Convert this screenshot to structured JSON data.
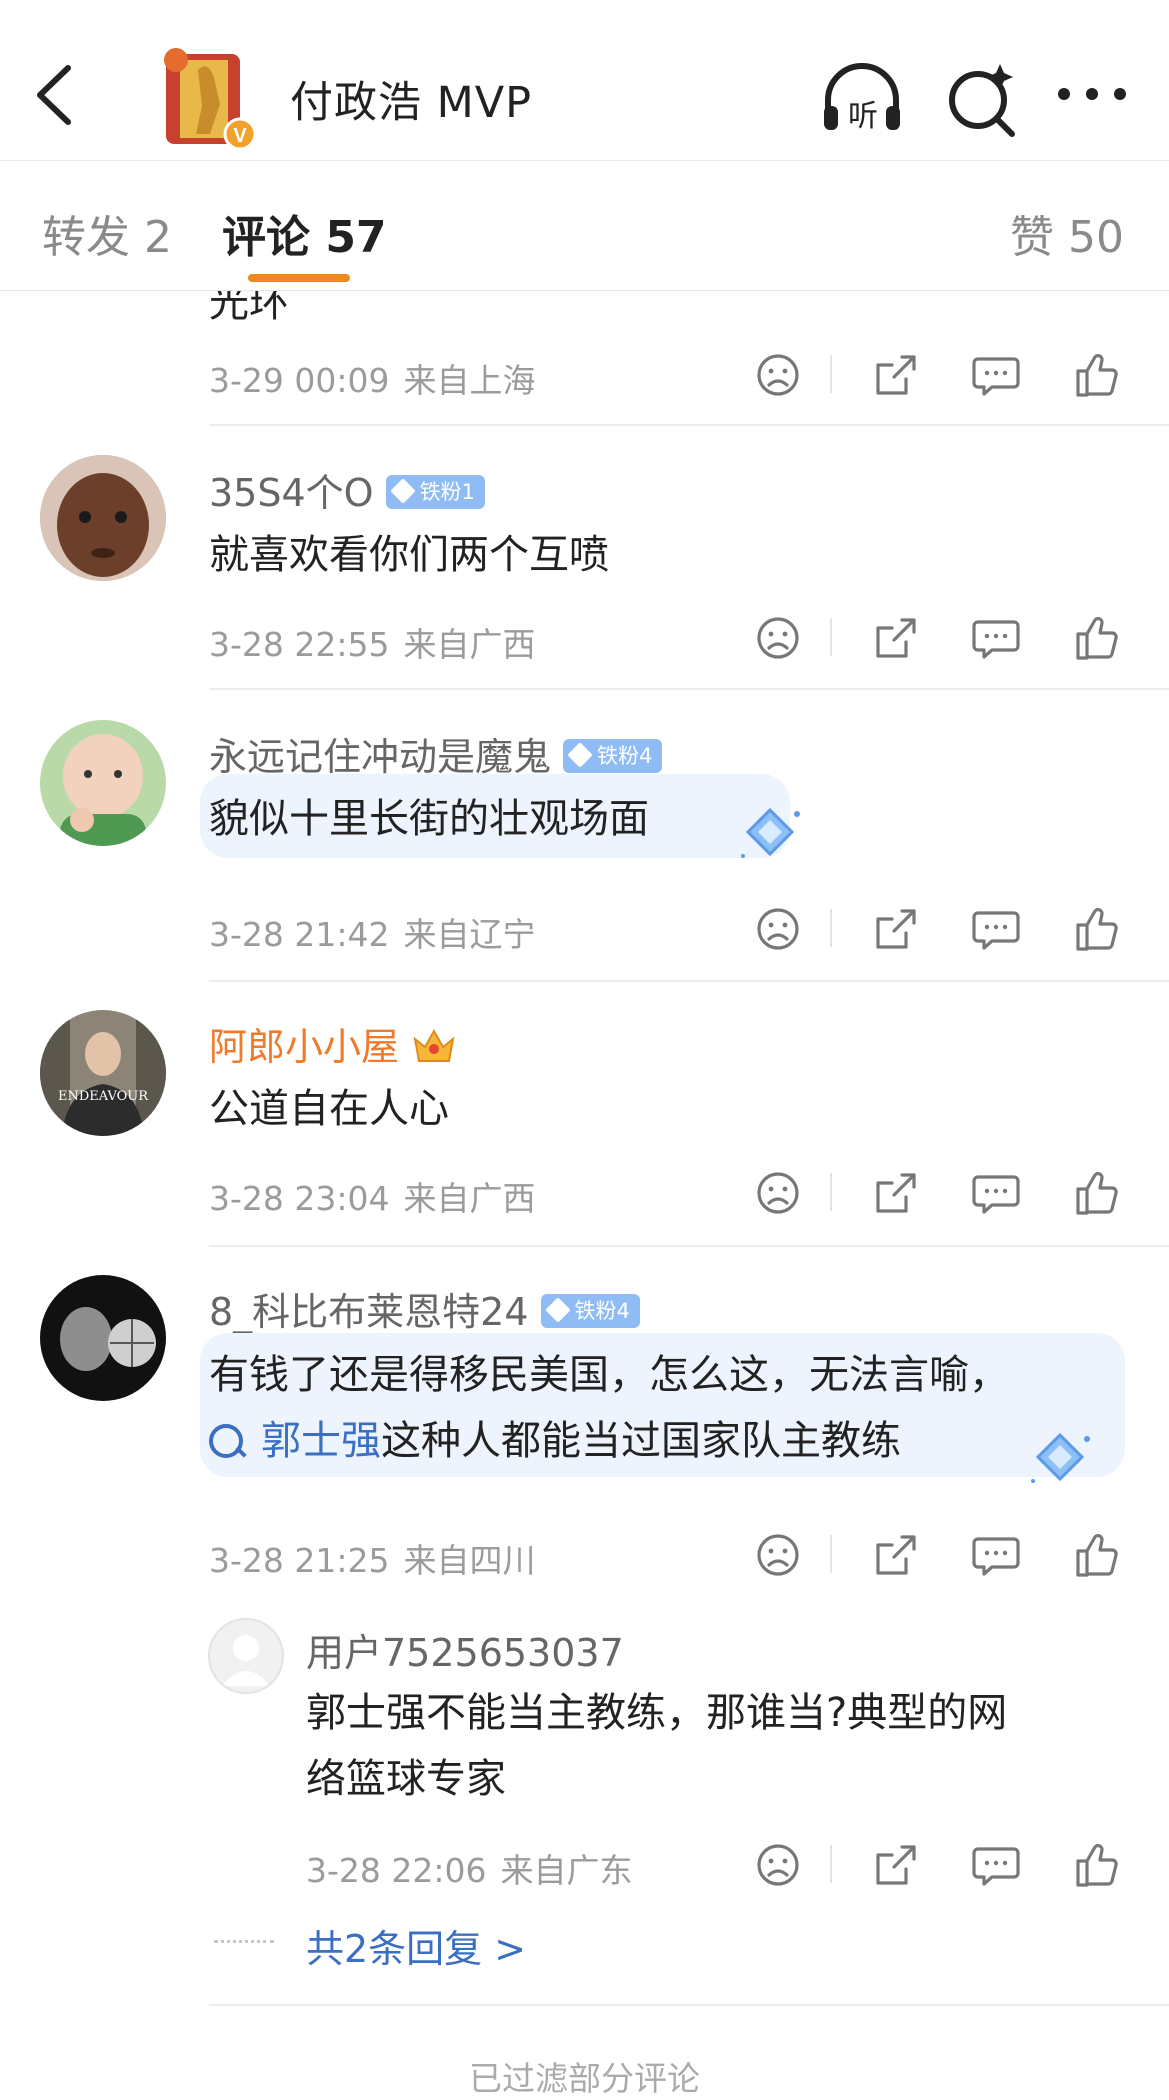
{
  "header": {
    "title": "付政浩 MVP",
    "accent_color": "#f08a1e",
    "icons": [
      "back-arrow-icon",
      "listen-headphone-icon",
      "search-sparkle-icon",
      "more-dots-icon"
    ],
    "listen_label": "听"
  },
  "tabs": [
    {
      "label": "转发 2"
    },
    {
      "label": "评论 57"
    },
    {
      "label": "赞 50"
    }
  ],
  "partial_comment": {
    "text": "光环",
    "time": "3-29 00:09",
    "location": "来自上海"
  },
  "comments": [
    {
      "user": "35S4个O",
      "badge": "铁粉1",
      "text": "就喜欢看你们两个互喷",
      "time": "3-28 22:55",
      "location": "来自广西"
    },
    {
      "user": "永远记住冲动是魔鬼",
      "badge": "铁粉4",
      "text": "貌似十里长街的壮观场面",
      "time": "3-28 21:42",
      "location": "来自辽宁"
    },
    {
      "user": "阿郎小小屋",
      "badge": "",
      "text": "公道自在人心",
      "time": "3-28 23:04",
      "location": "来自广西"
    },
    {
      "user": "8_科比布莱恩特24",
      "badge": "铁粉4",
      "text_line1": "有钱了还是得移民美国，怎么这，无法言喻，",
      "link": "郭士强",
      "text_line2_rest": "这种人都能当过国家队主教练",
      "time": "3-28 21:25",
      "location": "来自四川",
      "avatar_text": "ENDEAVOUR"
    }
  ],
  "avatar_labels": {
    "endeavour": "ENDEAVOUR"
  },
  "reply": {
    "user": "用户7525653037",
    "text_line1": "郭士强不能当主教练，那谁当?典型的网",
    "text_line2": "络篮球专家",
    "time": "3-28 22:06",
    "location": "来自广东"
  },
  "more_replies": "共2条回复 >",
  "footer_note": "已过滤部分评论"
}
